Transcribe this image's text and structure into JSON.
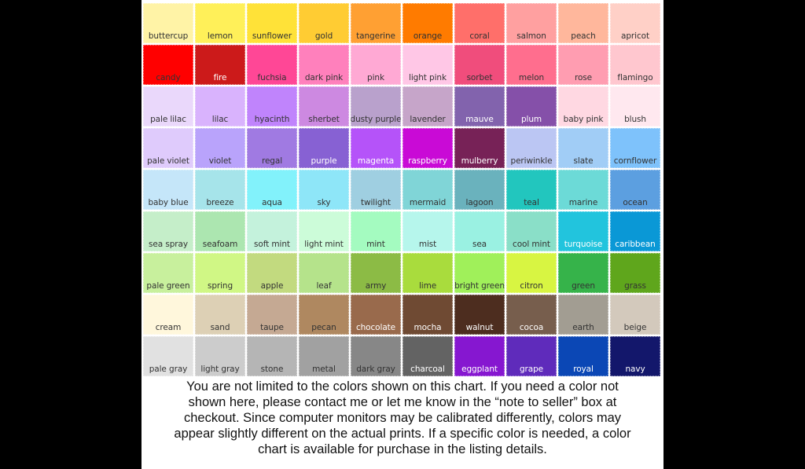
{
  "swatches": [
    {
      "name": "buttercup",
      "color": "#fff3a6",
      "text": "#333333"
    },
    {
      "name": "lemon",
      "color": "#fff059",
      "text": "#333333"
    },
    {
      "name": "sunflower",
      "color": "#ffe238",
      "text": "#333333"
    },
    {
      "name": "gold",
      "color": "#ffcc33",
      "text": "#333333"
    },
    {
      "name": "tangerine",
      "color": "#ffa033",
      "text": "#333333"
    },
    {
      "name": "orange",
      "color": "#ff7b00",
      "text": "#333333"
    },
    {
      "name": "coral",
      "color": "#ff6f6a",
      "text": "#333333"
    },
    {
      "name": "salmon",
      "color": "#ffa0a0",
      "text": "#333333"
    },
    {
      "name": "peach",
      "color": "#ffb79c",
      "text": "#333333"
    },
    {
      "name": "apricot",
      "color": "#ffd0c7",
      "text": "#333333"
    },
    {
      "name": "candy",
      "color": "#ff0000",
      "text": "#333333"
    },
    {
      "name": "fire",
      "color": "#cc1a1a",
      "text": "#ffffff"
    },
    {
      "name": "fuchsia",
      "color": "#ff4796",
      "text": "#333333"
    },
    {
      "name": "dark pink",
      "color": "#ff80bc",
      "text": "#333333"
    },
    {
      "name": "pink",
      "color": "#ffa9d4",
      "text": "#333333"
    },
    {
      "name": "light pink",
      "color": "#ffc7e6",
      "text": "#333333"
    },
    {
      "name": "sorbet",
      "color": "#f04d7c",
      "text": "#333333"
    },
    {
      "name": "melon",
      "color": "#ff6e8e",
      "text": "#333333"
    },
    {
      "name": "rose",
      "color": "#ff9db1",
      "text": "#333333"
    },
    {
      "name": "flamingo",
      "color": "#ffc7cf",
      "text": "#333333"
    },
    {
      "name": "pale lilac",
      "color": "#ead8fb",
      "text": "#333333"
    },
    {
      "name": "lilac",
      "color": "#d9b3fd",
      "text": "#333333"
    },
    {
      "name": "hyacinth",
      "color": "#c084fc",
      "text": "#333333"
    },
    {
      "name": "sherbet",
      "color": "#cd89e1",
      "text": "#333333"
    },
    {
      "name": "dusty purple",
      "color": "#b9a1cc",
      "text": "#333333"
    },
    {
      "name": "lavender",
      "color": "#c6a5c9",
      "text": "#333333"
    },
    {
      "name": "mauve",
      "color": "#8263ad",
      "text": "#ffffff"
    },
    {
      "name": "plum",
      "color": "#8550a9",
      "text": "#ffffff"
    },
    {
      "name": "baby pink",
      "color": "#ffd8e2",
      "text": "#333333"
    },
    {
      "name": "blush",
      "color": "#ffe8ef",
      "text": "#333333"
    },
    {
      "name": "pale violet",
      "color": "#dfcbfc",
      "text": "#333333"
    },
    {
      "name": "violet",
      "color": "#b9a3fb",
      "text": "#333333"
    },
    {
      "name": "regal",
      "color": "#a07ae2",
      "text": "#333333"
    },
    {
      "name": "purple",
      "color": "#8761d3",
      "text": "#ffffff"
    },
    {
      "name": "magenta",
      "color": "#b553f9",
      "text": "#ffffff"
    },
    {
      "name": "raspberry",
      "color": "#c90ad6",
      "text": "#ffffff"
    },
    {
      "name": "mulberry",
      "color": "#772257",
      "text": "#ffffff"
    },
    {
      "name": "periwinkle",
      "color": "#bbc6f3",
      "text": "#333333"
    },
    {
      "name": "slate",
      "color": "#a1cdf6",
      "text": "#333333"
    },
    {
      "name": "cornflower",
      "color": "#7ec2fb",
      "text": "#333333"
    },
    {
      "name": "baby blue",
      "color": "#c5e6f9",
      "text": "#333333"
    },
    {
      "name": "breeze",
      "color": "#a6e4ea",
      "text": "#333333"
    },
    {
      "name": "aqua",
      "color": "#82f2fb",
      "text": "#333333"
    },
    {
      "name": "sky",
      "color": "#8ee6f8",
      "text": "#333333"
    },
    {
      "name": "twilight",
      "color": "#9fcfe1",
      "text": "#333333"
    },
    {
      "name": "mermaid",
      "color": "#80d5d7",
      "text": "#333333"
    },
    {
      "name": "lagoon",
      "color": "#6ab2bd",
      "text": "#333333"
    },
    {
      "name": "teal",
      "color": "#22c6be",
      "text": "#333333"
    },
    {
      "name": "marine",
      "color": "#6cdad7",
      "text": "#333333"
    },
    {
      "name": "ocean",
      "color": "#5c9fe0",
      "text": "#333333"
    },
    {
      "name": "sea spray",
      "color": "#c5eec9",
      "text": "#333333"
    },
    {
      "name": "seafoam",
      "color": "#ace6b0",
      "text": "#333333"
    },
    {
      "name": "soft mint",
      "color": "#c4f2dc",
      "text": "#333333"
    },
    {
      "name": "light mint",
      "color": "#ccfcd9",
      "text": "#333333"
    },
    {
      "name": "mint",
      "color": "#a4fbc0",
      "text": "#333333"
    },
    {
      "name": "mist",
      "color": "#b6f6ec",
      "text": "#333333"
    },
    {
      "name": "sea",
      "color": "#9af1e2",
      "text": "#333333"
    },
    {
      "name": "cool mint",
      "color": "#8adfc8",
      "text": "#333333"
    },
    {
      "name": "turquoise",
      "color": "#22c4dd",
      "text": "#ffffff"
    },
    {
      "name": "caribbean",
      "color": "#0a98d6",
      "text": "#ffffff"
    },
    {
      "name": "pale green",
      "color": "#c8f09d",
      "text": "#333333"
    },
    {
      "name": "spring",
      "color": "#d0f785",
      "text": "#333333"
    },
    {
      "name": "apple",
      "color": "#c2da7f",
      "text": "#333333"
    },
    {
      "name": "leaf",
      "color": "#b5e38b",
      "text": "#333333"
    },
    {
      "name": "army",
      "color": "#8cbb45",
      "text": "#333333"
    },
    {
      "name": "lime",
      "color": "#a9dc3d",
      "text": "#333333"
    },
    {
      "name": "bright green",
      "color": "#a0f05a",
      "text": "#333333"
    },
    {
      "name": "citron",
      "color": "#d8f542",
      "text": "#333333"
    },
    {
      "name": "green",
      "color": "#36b34a",
      "text": "#333333"
    },
    {
      "name": "grass",
      "color": "#5fa61c",
      "text": "#333333"
    },
    {
      "name": "cream",
      "color": "#fff7dc",
      "text": "#333333"
    },
    {
      "name": "sand",
      "color": "#ddd0b5",
      "text": "#333333"
    },
    {
      "name": "taupe",
      "color": "#c5a993",
      "text": "#333333"
    },
    {
      "name": "pecan",
      "color": "#af8860",
      "text": "#333333"
    },
    {
      "name": "chocolate",
      "color": "#996a4c",
      "text": "#ffffff"
    },
    {
      "name": "mocha",
      "color": "#6f4a33",
      "text": "#ffffff"
    },
    {
      "name": "walnut",
      "color": "#4d2d1f",
      "text": "#ffffff"
    },
    {
      "name": "cocoa",
      "color": "#775e4d",
      "text": "#ffffff"
    },
    {
      "name": "earth",
      "color": "#a29d92",
      "text": "#333333"
    },
    {
      "name": "beige",
      "color": "#d3c9bc",
      "text": "#333333"
    },
    {
      "name": "pale gray",
      "color": "#e1e1e1",
      "text": "#333333"
    },
    {
      "name": "light gray",
      "color": "#cccccc",
      "text": "#333333"
    },
    {
      "name": "stone",
      "color": "#b5b5b5",
      "text": "#333333"
    },
    {
      "name": "metal",
      "color": "#a1a1a1",
      "text": "#333333"
    },
    {
      "name": "dark gray",
      "color": "#878787",
      "text": "#333333"
    },
    {
      "name": "charcoal",
      "color": "#636363",
      "text": "#ffffff"
    },
    {
      "name": "eggplant",
      "color": "#8617d0",
      "text": "#ffffff"
    },
    {
      "name": "grape",
      "color": "#5f2bbb",
      "text": "#ffffff"
    },
    {
      "name": "royal",
      "color": "#0b47b5",
      "text": "#ffffff"
    },
    {
      "name": "navy",
      "color": "#13176b",
      "text": "#ffffff"
    }
  ],
  "note": {
    "lines": [
      "You are not limited to the colors shown on this chart. If you need a color not",
      "shown here, please contact me or let me know in the “note to seller” box at",
      "checkout. Since computer monitors may be calibrated differently, colors may",
      "appear slightly different on the actual prints. If a specific color is needed, a color",
      "chart is available for purchase in the listing details."
    ]
  }
}
